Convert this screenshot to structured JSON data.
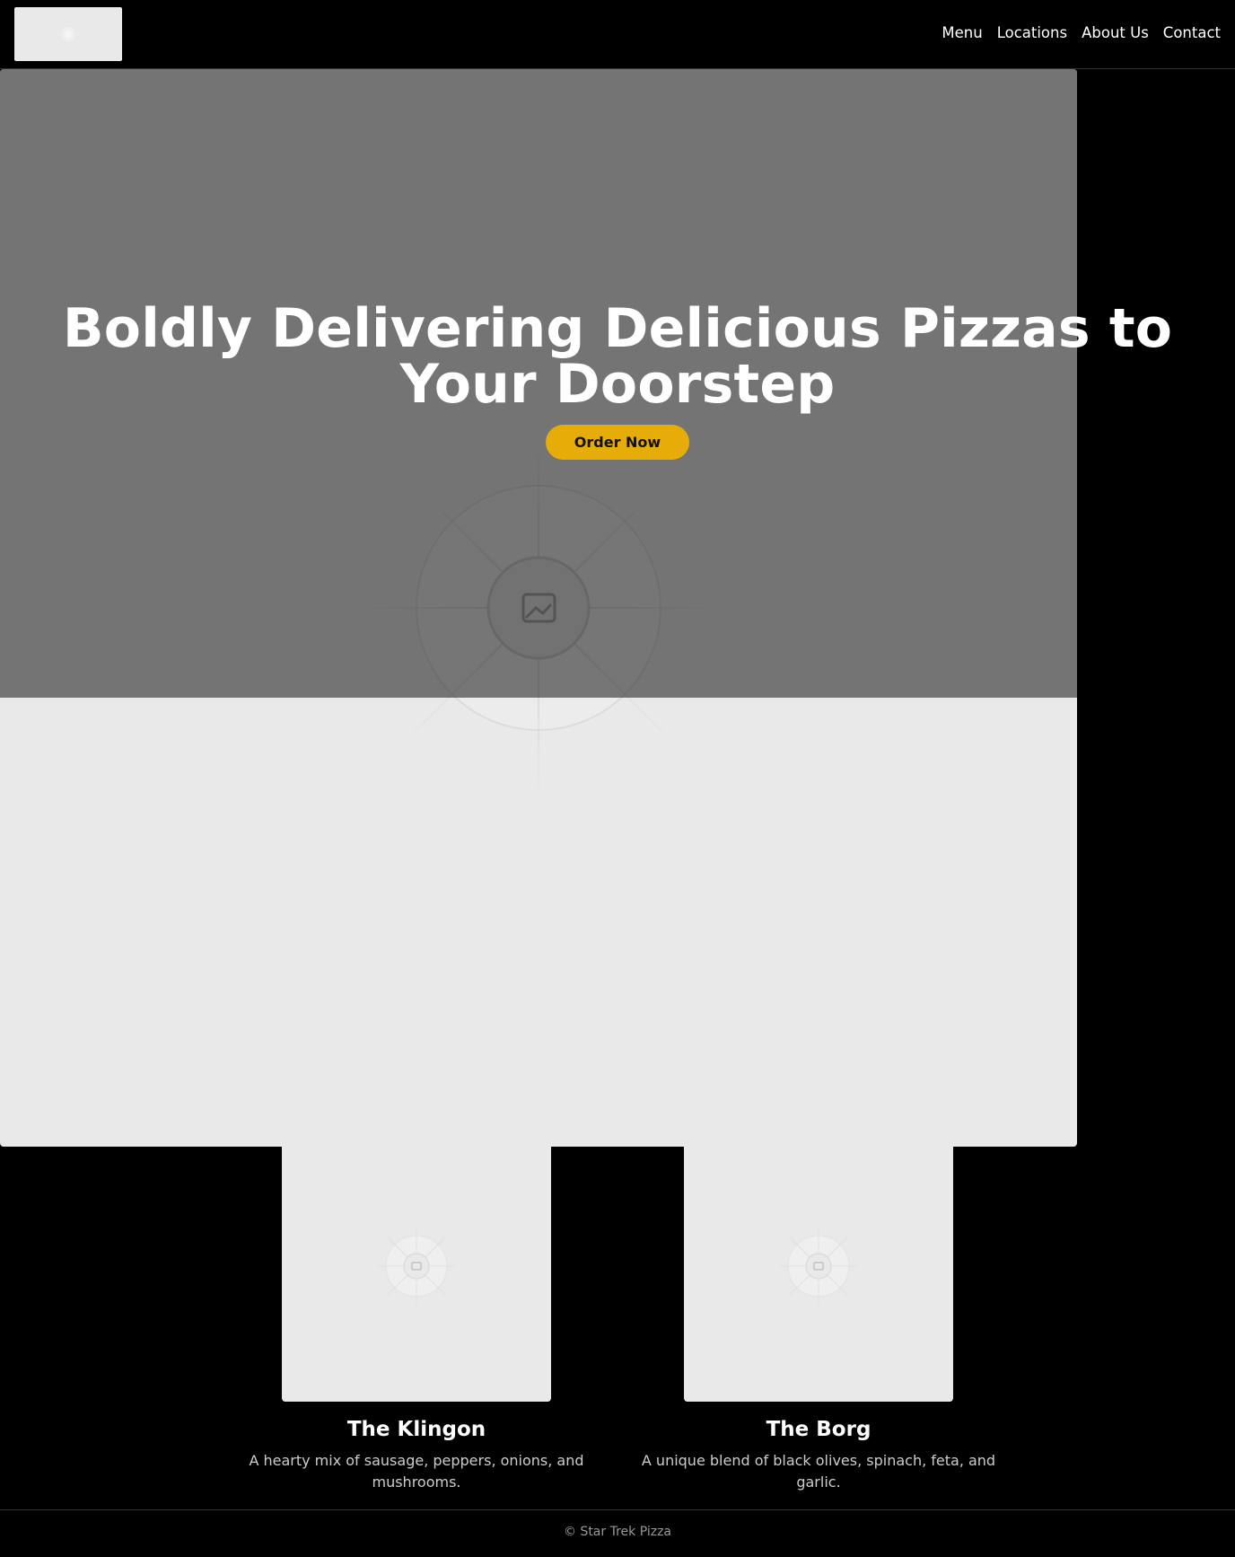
{
  "header": {
    "logo_icon": "image-placeholder-icon",
    "nav": [
      "Menu",
      "Locations",
      "About Us",
      "Contact"
    ]
  },
  "hero": {
    "title": "Boldly Delivering Delicious Pizzas to Your Doorstep",
    "cta": "Order Now",
    "cta_color": "#e6ac07",
    "image_icon": "image-placeholder-icon"
  },
  "cards": [
    {
      "title": "The Klingon",
      "description": "A hearty mix of sausage, peppers, onions, and mushrooms.",
      "image_icon": "image-placeholder-icon"
    },
    {
      "title": "The Borg",
      "description": "A unique blend of black olives, spinach, feta, and garlic.",
      "image_icon": "image-placeholder-icon"
    }
  ],
  "footer": {
    "copyright": "© Star Trek Pizza"
  }
}
